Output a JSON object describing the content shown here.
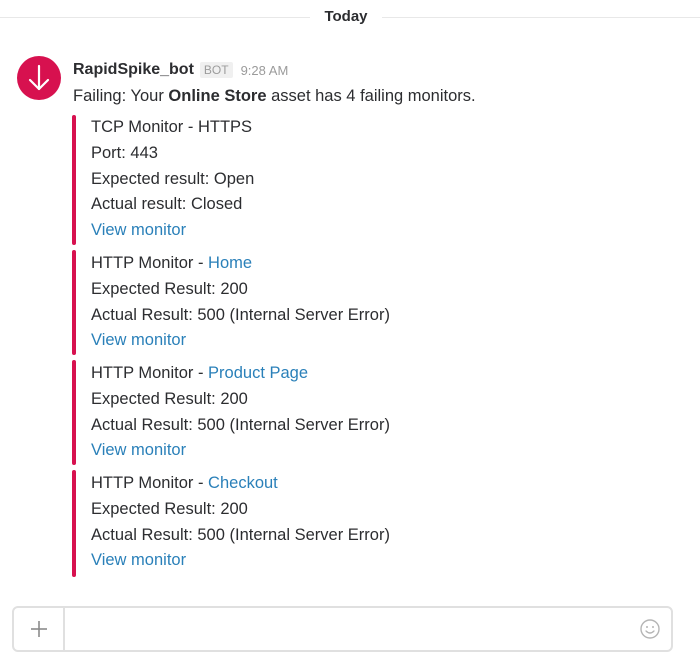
{
  "day_divider": {
    "label": "Today"
  },
  "message": {
    "sender": "RapidSpike_bot",
    "badge": "BOT",
    "time": "9:28 AM",
    "avatar_icon": "arrow-down-icon",
    "accent_color": "#d7114f",
    "text_prefix": "Failing: Your ",
    "text_bold": "Online Store",
    "text_suffix": " asset has 4 failing monitors."
  },
  "attachments": [
    {
      "title_prefix": "TCP Monitor - HTTPS",
      "title_link": "",
      "lines": [
        "Port: 443",
        "Expected result: Open",
        "Actual result: Closed"
      ],
      "link_label": "View monitor"
    },
    {
      "title_prefix": "HTTP Monitor - ",
      "title_link": "Home",
      "lines": [
        "Expected Result: 200",
        "Actual Result: 500 (Internal Server Error)"
      ],
      "link_label": "View monitor"
    },
    {
      "title_prefix": "HTTP Monitor - ",
      "title_link": "Product Page",
      "lines": [
        "Expected Result: 200",
        "Actual Result: 500 (Internal Server Error)"
      ],
      "link_label": "View monitor"
    },
    {
      "title_prefix": "HTTP Monitor - ",
      "title_link": "Checkout",
      "lines": [
        "Expected Result: 200",
        "Actual Result: 500 (Internal Server Error)"
      ],
      "link_label": "View monitor"
    }
  ],
  "composer": {
    "value": "",
    "placeholder": "",
    "plus_icon": "plus-icon",
    "emoji_icon": "emoji-icon"
  }
}
